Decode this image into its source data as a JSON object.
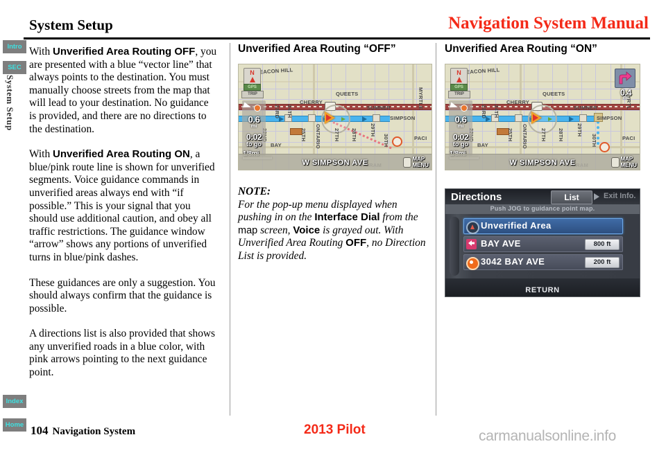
{
  "header": {
    "section_title": "System Setup",
    "manual_title": "Navigation System Manual",
    "manual_title_color": "#f42a18"
  },
  "side_tabs": [
    {
      "label": "Intro",
      "name": "intro"
    },
    {
      "label": "SEC",
      "name": "sec"
    },
    {
      "label": "Index",
      "name": "index"
    },
    {
      "label": "Home",
      "name": "home"
    }
  ],
  "side_chapter_label": "System Setup",
  "left_column": {
    "paragraphs": [
      {
        "runs": [
          {
            "text": "With ",
            "style": "serif"
          },
          {
            "text": "Unverified Area Routing OFF",
            "style": "bold-sans"
          },
          {
            "text": ", you are presented with a blue “vector line” that always points to the destination. You must manually choose streets from the map that will lead to your destination. No guidance is provided, and there are no directions to the destination.",
            "style": "serif"
          }
        ]
      },
      {
        "runs": [
          {
            "text": "With ",
            "style": "serif"
          },
          {
            "text": "Unverified Area Routing ON",
            "style": "bold-sans"
          },
          {
            "text": ", a blue/pink route line is shown for unverified segments. Voice guidance commands in unverified areas always end with “if possible.” This is your signal that you should use additional caution, and obey all traffic restrictions. The guidance window “arrow” shows any portions of unverified turns in blue/pink dashes.",
            "style": "serif"
          }
        ]
      },
      {
        "runs": [
          {
            "text": "These guidances are only a suggestion. You should always confirm that the guidance is possible.",
            "style": "serif"
          }
        ]
      },
      {
        "runs": [
          {
            "text": "A directions list is also provided that shows any unverified roads in a blue color, with pink arrows pointing to the next guidance point.",
            "style": "serif"
          }
        ]
      }
    ]
  },
  "middle_column": {
    "heading": "Unverified Area Routing “OFF”",
    "note": {
      "label": "NOTE:",
      "runs": [
        {
          "text": "For the pop-up menu displayed when pushing in on the ",
          "style": "italic"
        },
        {
          "text": "Interface Dial",
          "style": "bold-sans"
        },
        {
          "text": " from the ",
          "style": "italic"
        },
        {
          "text": "map",
          "style": "sans"
        },
        {
          "text": " screen, ",
          "style": "italic"
        },
        {
          "text": "Voice",
          "style": "bold-sans"
        },
        {
          "text": " is grayed out. With Unverified Area Routing ",
          "style": "italic"
        },
        {
          "text": "OFF",
          "style": "bold-sans"
        },
        {
          "text": ", no Direction List is provided.",
          "style": "italic"
        }
      ]
    }
  },
  "right_column": {
    "heading": "Unverified Area Routing “ON”"
  },
  "map_off": {
    "compass_label": "N",
    "gps_label": "GPS",
    "trip_label": "TRIP",
    "distance_value": "0.6",
    "distance_unit": "mi",
    "eta_value": "0:02",
    "eta_label": "to go",
    "scale_label": "1/8mi",
    "street_name": "W SIMPSON AVE",
    "map_menu_line1": "MAP",
    "map_menu_line2": "MENU",
    "street_labels": [
      "EACON HILL",
      "QUEETS",
      "CHERRY",
      "SUMNER",
      "SIMPSON",
      "BAY",
      "PACI",
      "INGRAM",
      "MYRTLE",
      "22ND",
      "23RD",
      "24TH",
      "25TH",
      "27TH",
      "28TH",
      "29TH",
      "30TH",
      "ONTARIO"
    ]
  },
  "map_on": {
    "compass_label": "N",
    "gps_label": "GPS",
    "trip_label": "TRIP",
    "distance_value": "0.6",
    "distance_unit": "mi",
    "eta_value": "0:02",
    "eta_label": "to go",
    "scale_label": "1/8mi",
    "turn_distance": "0.4",
    "turn_distance_unit": "mi",
    "street_name": "W SIMPSON AVE",
    "map_menu_line1": "MAP",
    "map_menu_line2": "MENU",
    "street_labels": [
      "EACON HILL",
      "QUEETS",
      "CHERRY",
      "SUMNER",
      "SIMPSON",
      "BAY",
      "PACI",
      "INGRAM",
      "MYRTL",
      "22ND",
      "23RD",
      "24TH",
      "25TH",
      "27TH",
      "28TH",
      "29TH",
      "30TH",
      "ONTARIO"
    ]
  },
  "directions_screen": {
    "title": "Directions",
    "tab_list": "List",
    "tab_exit_info": "Exit Info.",
    "subtitle": "Push JOG to guidance point map.",
    "rows": [
      {
        "name": "Unverified Area",
        "distance": "",
        "icon": "unverified-area-icon",
        "selected": true
      },
      {
        "name": "BAY AVE",
        "distance": "800 ft",
        "icon": "pink-turn-arrow-icon",
        "selected": false
      },
      {
        "name": "3042 BAY AVE",
        "distance": "200 ft",
        "icon": "destination-icon",
        "selected": false
      }
    ],
    "return_label": "RETURN"
  },
  "footer": {
    "page_number": "104",
    "page_section": "Navigation System",
    "model_year": "2013 Pilot",
    "watermark": "carmanualsonline.info"
  }
}
